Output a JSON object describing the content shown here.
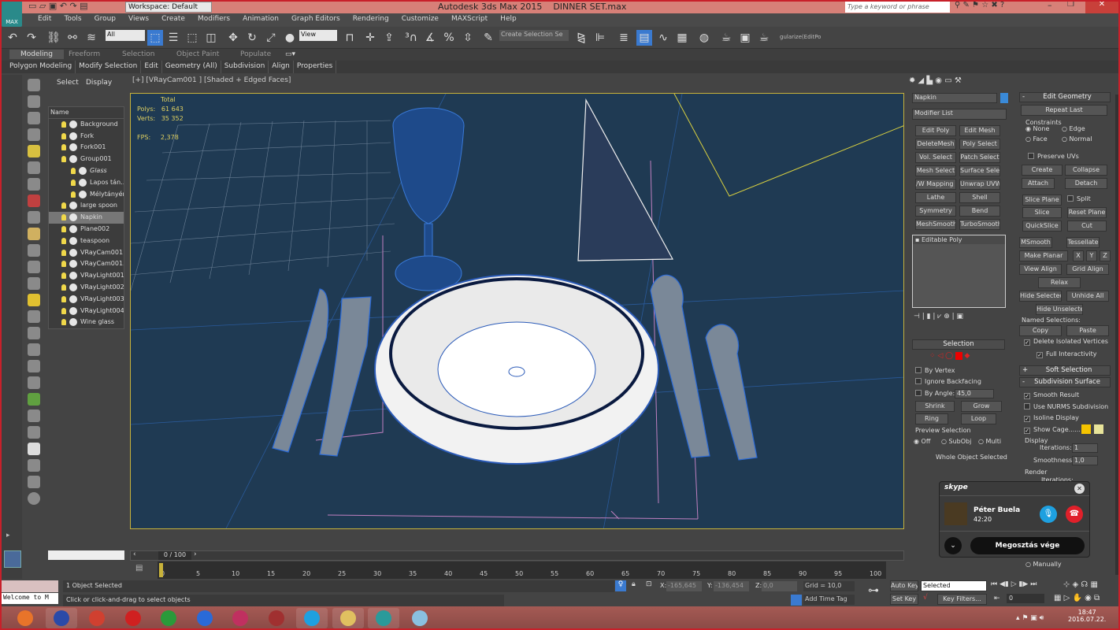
{
  "titlebar": {
    "app": "Autodesk 3ds Max  2015",
    "file": "DINNER SET.max",
    "workspace": "Workspace: Default",
    "search_placeholder": "Type a keyword or phrase",
    "logo": "MAX"
  },
  "menu": [
    "Edit",
    "Tools",
    "Group",
    "Views",
    "Create",
    "Modifiers",
    "Animation",
    "Graph Editors",
    "Rendering",
    "Customize",
    "MAXScript",
    "Help"
  ],
  "toolbar": {
    "selection_filter": "All",
    "ref_coord": "View",
    "named_selection": "Create Selection Se",
    "script_field": "gularize(EditPo"
  },
  "ribbon": {
    "tabs": [
      "Modeling",
      "Freeform",
      "Selection",
      "Object Paint",
      "Populate"
    ],
    "active_tab": "Modeling",
    "panels": [
      "Polygon Modeling",
      "Modify Selection",
      "Edit",
      "Geometry (All)",
      "Subdivision",
      "Align",
      "Properties"
    ]
  },
  "explorer": {
    "tabs": [
      "Select",
      "Display"
    ],
    "column": "Name",
    "items": [
      {
        "name": "Background",
        "indent": 0
      },
      {
        "name": "Fork",
        "indent": 0
      },
      {
        "name": "Fork001",
        "indent": 0
      },
      {
        "name": "Group001",
        "indent": 0
      },
      {
        "name": "Glass",
        "indent": 1
      },
      {
        "name": "Lapos tán...",
        "indent": 1
      },
      {
        "name": "Mélytányér",
        "indent": 1
      },
      {
        "name": "large spoon",
        "indent": 0
      },
      {
        "name": "Napkin",
        "indent": 0,
        "selected": true
      },
      {
        "name": "Plane002",
        "indent": 0
      },
      {
        "name": "teaspoon",
        "indent": 0
      },
      {
        "name": "VRayCam001",
        "indent": 0
      },
      {
        "name": "VRayCam001...",
        "indent": 0
      },
      {
        "name": "VRayLight001",
        "indent": 0
      },
      {
        "name": "VRayLight002",
        "indent": 0
      },
      {
        "name": "VRayLight003",
        "indent": 0
      },
      {
        "name": "VRayLight004",
        "indent": 0
      },
      {
        "name": "Wine glass",
        "indent": 0
      }
    ]
  },
  "viewport": {
    "label": "[+] [VRayCam001 ] [Shaded + Edged Faces]",
    "stats": {
      "total": "Total",
      "polys_label": "Polys:",
      "polys": "61 643",
      "verts_label": "Verts:",
      "verts": "35 352",
      "fps_label": "FPS:",
      "fps": "2,378"
    }
  },
  "timeline": {
    "frame": "0 / 100",
    "ticks": [
      "0",
      "5",
      "10",
      "15",
      "20",
      "25",
      "30",
      "35",
      "40",
      "45",
      "50",
      "55",
      "60",
      "65",
      "70",
      "75",
      "80",
      "85",
      "90",
      "95",
      "100"
    ]
  },
  "status": {
    "selected": "1 Object Selected",
    "prompt": "Click or click-and-drag to select objects",
    "listener": "Welcome to M",
    "x_label": "X:",
    "x": "-165,645",
    "y_label": "Y:",
    "y": "-136,454",
    "z_label": "Z:",
    "z": "0,0",
    "grid": "Grid = 10,0",
    "add_time_tag": "Add Time Tag",
    "auto_key": "Auto Key",
    "set_key": "Set Key",
    "key_mode": "Selected",
    "key_filters": "Key Filters...",
    "current_frame": "0"
  },
  "command_panel": {
    "object_name": "Napkin",
    "object_color": "#3a8ad8",
    "modifier_list": "Modifier List",
    "modifier_buttons": [
      "Edit Poly",
      "Edit Mesh",
      "DeleteMesh",
      "Poly Select",
      "Vol. Select",
      "Patch Select",
      "Mesh Select",
      "Surface Select",
      "/W Mapping Ac",
      "Unwrap UVW",
      "Lathe",
      "Shell",
      "Symmetry",
      "Bend",
      "MeshSmooth",
      "TurboSmooth"
    ],
    "stack": "Editable Poly",
    "selection": {
      "title": "Selection",
      "by_vertex": "By Vertex",
      "ignore_backfacing": "Ignore Backfacing",
      "by_angle": "By Angle:",
      "angle": "45,0",
      "shrink": "Shrink",
      "grow": "Grow",
      "ring": "Ring",
      "loop": "Loop",
      "preview": "Preview Selection",
      "off": "Off",
      "subobj": "SubObj",
      "multi": "Multi",
      "info": "Whole Object Selected"
    },
    "edit_geometry": {
      "title": "Edit Geometry",
      "repeat_last": "Repeat Last",
      "constraints": "Constraints",
      "none": "None",
      "edge": "Edge",
      "face": "Face",
      "normal": "Normal",
      "preserve_uvs": "Preserve UVs",
      "create": "Create",
      "collapse": "Collapse",
      "attach": "Attach",
      "detach": "Detach",
      "slice_plane": "Slice Plane",
      "split": "Split",
      "slice": "Slice",
      "reset_plane": "Reset Plane",
      "quickslice": "QuickSlice",
      "cut": "Cut",
      "msmooth": "MSmooth",
      "tessellate": "Tessellate",
      "make_planar": "Make Planar",
      "x": "X",
      "y": "Y",
      "z": "Z",
      "view_align": "View Align",
      "grid_align": "Grid Align",
      "relax": "Relax",
      "hide_selected": "Hide Selected",
      "unhide_all": "Unhide All",
      "hide_unselected": "Hide Unselected",
      "named_selections": "Named Selections:",
      "copy": "Copy",
      "paste": "Paste",
      "delete_isolated": "Delete Isolated Vertices",
      "full_interactivity": "Full Interactivity"
    },
    "soft_selection": "Soft Selection",
    "subdivision": {
      "title": "Subdivision Surface",
      "smooth_result": "Smooth Result",
      "use_nurms": "Use NURMS Subdivision",
      "isoline": "Isoline Display",
      "show_cage": "Show Cage......",
      "cage_colors": [
        "#f5c400",
        "#e8e49a"
      ],
      "display": "Display",
      "iterations_label": "Iterations:",
      "iterations": "1",
      "smoothness_label": "Smoothness:",
      "smoothness": "1,0",
      "render": "Render",
      "render_iterations": "Iterations:",
      "manually": "Manually"
    }
  },
  "skype": {
    "logo": "skype",
    "caller": "Péter Buela",
    "duration": "42:20",
    "end_share": "Megosztás vége",
    "mic_color": "#1ea0e0",
    "hangup_color": "#e0202a"
  },
  "tray": {
    "time": "18:47",
    "date": "2016.07.22."
  },
  "taskbar": [
    "firefox",
    "save",
    "ccleaner",
    "video-downloader",
    "utorrent",
    "flashget",
    "winrar",
    "disc-burner",
    "skype",
    "explorer",
    "3ds-max",
    "paint"
  ]
}
